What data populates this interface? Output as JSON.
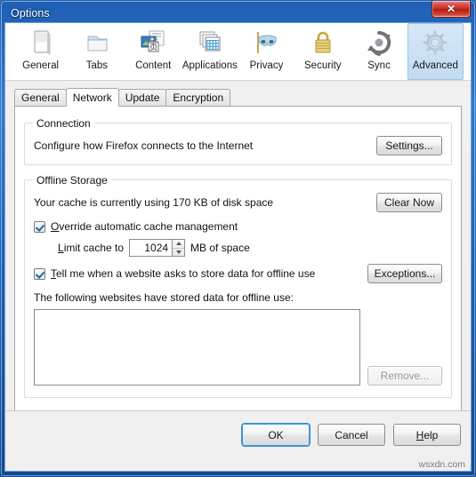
{
  "window": {
    "title": "Options",
    "close_label": "✕"
  },
  "toolbar": {
    "items": [
      {
        "label": "General",
        "icon": "general-document-icon"
      },
      {
        "label": "Tabs",
        "icon": "tabs-folder-icon"
      },
      {
        "label": "Content",
        "icon": "content-page-icon"
      },
      {
        "label": "Applications",
        "icon": "applications-windows-icon"
      },
      {
        "label": "Privacy",
        "icon": "privacy-mask-icon"
      },
      {
        "label": "Security",
        "icon": "security-padlock-icon"
      },
      {
        "label": "Sync",
        "icon": "sync-arrows-icon"
      },
      {
        "label": "Advanced",
        "icon": "advanced-gear-icon"
      }
    ],
    "selected": "Advanced"
  },
  "inner_tabs": {
    "items": [
      {
        "label": "General"
      },
      {
        "label": "Network"
      },
      {
        "label": "Update"
      },
      {
        "label": "Encryption"
      }
    ],
    "selected": "Network"
  },
  "connection": {
    "title": "Connection",
    "description": "Configure how Firefox connects to the Internet",
    "settings_button": "Settings..."
  },
  "offline_storage": {
    "title": "Offline Storage",
    "cache_usage_text": "Your cache is currently using 170 KB of disk space",
    "cache_size": "170 KB",
    "clear_now_button": "Clear Now",
    "override_checkbox_label": "Override automatic cache management",
    "override_checked": true,
    "limit_prefix": "Limit cache to",
    "limit_value": "1024",
    "limit_suffix": "MB of space",
    "tell_me_checkbox_label": "Tell me when a website asks to store data for offline use",
    "tell_me_checked": true,
    "exceptions_button": "Exceptions...",
    "list_label": "The following websites have stored data for offline use:",
    "stored_sites": [],
    "remove_button": "Remove...",
    "remove_enabled": false
  },
  "footer": {
    "ok_button": "OK",
    "cancel_button": "Cancel",
    "help_button": "Help",
    "watermark": "wsxdn.com"
  },
  "colors": {
    "titlebar_blue": "#2f78cf",
    "close_red": "#c32d21",
    "selected_tab_blue": "#c3dcf3",
    "default_focus_blue": "#3c93d4",
    "panel_white": "#ffffff",
    "dialog_gray": "#f0f0f0"
  }
}
